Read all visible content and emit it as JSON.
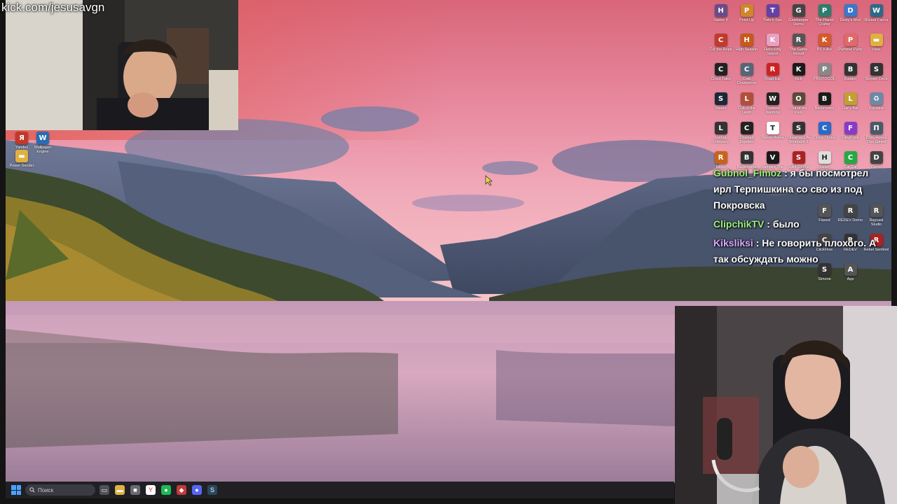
{
  "stream": {
    "url_label": "kick.com/jesusavgn"
  },
  "desktop": {
    "left_icons": [
      {
        "label": "Yandex",
        "icon": "yandex-icon",
        "color": "#c0392b"
      },
      {
        "label": "Wallpaper Engine",
        "icon": "wallpaper-engine-icon",
        "color": "#2b6cb0"
      },
      {
        "label": "Power Sender",
        "icon": "folder-icon",
        "color": "#e0b040"
      }
    ],
    "grid_icons": [
      {
        "label": "Hades II",
        "icon": "game-icon",
        "color": "#6b4b8a",
        "glyph": "H"
      },
      {
        "label": "Point Up",
        "icon": "game-icon",
        "color": "#d0862a",
        "glyph": "P"
      },
      {
        "label": "Twitch Spo",
        "icon": "twitch-icon",
        "color": "#6441a5",
        "glyph": "T"
      },
      {
        "label": "Gatekeeper Demo",
        "icon": "game-icon",
        "color": "#444444",
        "glyph": "G"
      },
      {
        "label": "The Planet Crafter",
        "icon": "game-icon",
        "color": "#2d7d6e",
        "glyph": "P"
      },
      {
        "label": "Dusty's Mod",
        "icon": "game-icon",
        "color": "#3a78c9",
        "glyph": "D"
      },
      {
        "label": "Wizard Factor",
        "icon": "game-icon",
        "color": "#2c6a8a",
        "glyph": "W"
      },
      {
        "label": "Cut the Rope",
        "icon": "game-icon",
        "color": "#c23a2a",
        "glyph": "C"
      },
      {
        "label": "High Season",
        "icon": "game-icon",
        "color": "#c55a1a",
        "glyph": "H"
      },
      {
        "label": "Hello Kitty Island",
        "icon": "game-icon",
        "color": "#e8a0c0",
        "glyph": "K"
      },
      {
        "label": "The Game Result",
        "icon": "game-icon",
        "color": "#555555",
        "glyph": "R"
      },
      {
        "label": "PC Killer",
        "icon": "game-icon",
        "color": "#d45a2a",
        "glyph": "K"
      },
      {
        "label": "Pummel Party",
        "icon": "game-icon",
        "color": "#e06a6a",
        "glyph": "P"
      },
      {
        "label": "New",
        "icon": "folder-icon",
        "color": "#e0b040",
        "glyph": "▬"
      },
      {
        "label": "Cloud Tales",
        "icon": "game-icon",
        "color": "#222222",
        "glyph": "C"
      },
      {
        "label": "Crab Champions",
        "icon": "game-icon",
        "color": "#556677",
        "glyph": "C"
      },
      {
        "label": "Road Eat",
        "icon": "game-icon",
        "color": "#cc2222",
        "glyph": "R"
      },
      {
        "label": "Kick",
        "icon": "kick-icon",
        "color": "#1a1a1a",
        "glyph": "K"
      },
      {
        "label": "PROTOCOL",
        "icon": "game-icon",
        "color": "#888888",
        "glyph": "P"
      },
      {
        "label": "Balatro",
        "icon": "game-icon",
        "color": "#333333",
        "glyph": "B"
      },
      {
        "label": "Stream Deck",
        "icon": "game-icon",
        "color": "#333333",
        "glyph": "S"
      },
      {
        "label": "Steam",
        "icon": "steam-icon",
        "color": "#1b2838",
        "glyph": "S"
      },
      {
        "label": "Cult of the Lamb",
        "icon": "game-icon",
        "color": "#b0503a",
        "glyph": "L"
      },
      {
        "label": "Content Warning",
        "icon": "game-icon",
        "color": "#222222",
        "glyph": "W"
      },
      {
        "label": "Out of the Park",
        "icon": "game-icon",
        "color": "#5a4a3a",
        "glyph": "O"
      },
      {
        "label": "Backrooms",
        "icon": "game-icon",
        "color": "#1a1a1a",
        "glyph": "B"
      },
      {
        "label": "Liar's Bar",
        "icon": "game-icon",
        "color": "#c0a030",
        "glyph": "L"
      },
      {
        "label": "Корзина",
        "icon": "recycle-bin-icon",
        "color": "#6a8aa8",
        "glyph": "♻"
      },
      {
        "label": "Lethal Company",
        "icon": "game-icon",
        "color": "#333333",
        "glyph": "L"
      },
      {
        "label": "Chained Together",
        "icon": "game-icon",
        "color": "#222222",
        "glyph": "C"
      },
      {
        "label": "Tarkov Arena",
        "icon": "game-icon",
        "color": "#ffffff",
        "glyph": "T"
      },
      {
        "label": "Streamer Life Simulator 2",
        "icon": "game-icon",
        "color": "#333333",
        "glyph": "S"
      },
      {
        "label": "Clone Drone",
        "icon": "game-icon",
        "color": "#2a6ac9",
        "glyph": "C"
      },
      {
        "label": "FlingPunk",
        "icon": "game-icon",
        "color": "#8a3ac9",
        "glyph": "F"
      },
      {
        "label": "Пять Ночей Под Дачей",
        "icon": "game-icon",
        "color": "#4a5a6a",
        "glyph": "П"
      },
      {
        "label": "Repo",
        "icon": "game-icon",
        "color": "#c8641a",
        "glyph": "R"
      },
      {
        "label": "Backrooms",
        "icon": "game-icon",
        "color": "#333333",
        "glyph": "B"
      },
      {
        "label": "Vampire The",
        "icon": "game-icon",
        "color": "#1a1a1a",
        "glyph": "V"
      },
      {
        "label": "Spirit Of The",
        "icon": "game-icon",
        "color": "#aa2222",
        "glyph": "S"
      },
      {
        "label": "Heart Battlefield",
        "icon": "game-icon",
        "color": "#dddddd",
        "glyph": "H"
      },
      {
        "label": "Car Car",
        "icon": "game-icon",
        "color": "#22aa44",
        "glyph": "C"
      },
      {
        "label": "Demo",
        "icon": "game-icon",
        "color": "#444444",
        "glyph": "D"
      }
    ],
    "extra_icons": [
      {
        "label": "Flaxed",
        "icon": "game-icon",
        "color": "#555555",
        "glyph": "F"
      },
      {
        "label": "REDEV Demo",
        "icon": "game-icon",
        "color": "#444444",
        "glyph": "R"
      },
      {
        "label": "Raycast Studio",
        "icon": "game-icon",
        "color": "#555555",
        "glyph": "R"
      },
      {
        "label": "ClickFlow",
        "icon": "game-icon",
        "color": "#444444",
        "glyph": "C"
      },
      {
        "label": "REDEV",
        "icon": "game-icon",
        "color": "#333333",
        "glyph": "R"
      },
      {
        "label": "Rebel Sentinel",
        "icon": "game-icon",
        "color": "#aa2222",
        "glyph": "R"
      },
      {
        "label": "Simone",
        "icon": "game-icon",
        "color": "#333333",
        "glyph": "S"
      },
      {
        "label": "App",
        "icon": "game-icon",
        "color": "#555555",
        "glyph": "A"
      }
    ]
  },
  "taskbar": {
    "search_placeholder": "Поиск",
    "apps": [
      {
        "name": "task-view-icon",
        "color": "#50505a",
        "glyph": "▭"
      },
      {
        "name": "file-explorer-icon",
        "color": "#e0b040",
        "glyph": "▬"
      },
      {
        "name": "folder-icon",
        "color": "#6a6a74",
        "glyph": "■"
      },
      {
        "name": "yandex-browser-icon",
        "color": "#ffffff",
        "glyph": "Y"
      },
      {
        "name": "spotify-icon",
        "color": "#1db954",
        "glyph": "●"
      },
      {
        "name": "app-icon",
        "color": "#c23a3a",
        "glyph": "◆"
      },
      {
        "name": "discord-icon",
        "color": "#5865f2",
        "glyph": "●"
      },
      {
        "name": "steam-icon",
        "color": "#2a475e",
        "glyph": "S"
      }
    ]
  },
  "chat": {
    "messages": [
      {
        "user": "Gubnol_Fimoz",
        "user_color": "#9bf07a",
        "text": "я бы посмотрел ирл Терпишкина со сво из под Покровска"
      },
      {
        "user": "ClipchikTV",
        "user_color": "#9bf07a",
        "text": "было"
      },
      {
        "user": "Kiksliksi",
        "user_color": "#d9a9ff",
        "text": "Не говорить плохого. А так обсуждать можно"
      }
    ]
  }
}
